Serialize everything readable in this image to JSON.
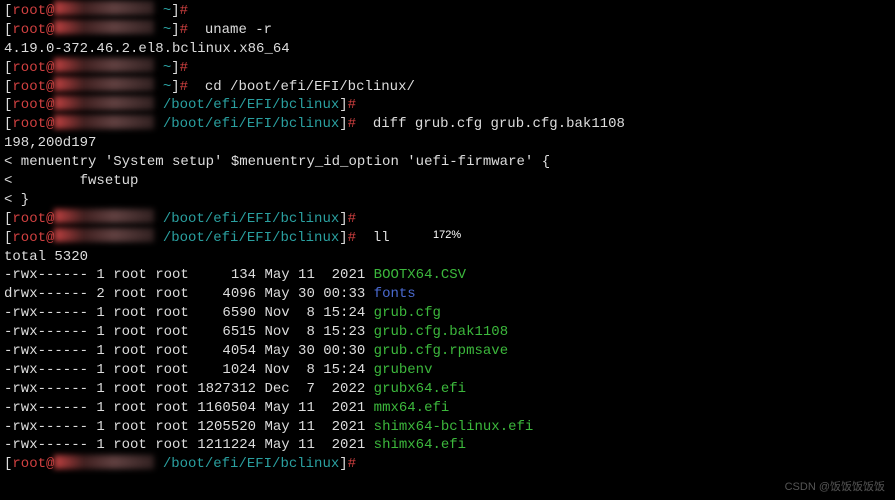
{
  "prompt": {
    "user": "root@",
    "home_dir": "~",
    "boot_dir": "/boot/efi/EFI/bclinux"
  },
  "commands": {
    "uname": "uname -r",
    "uname_output": "4.19.0-372.46.2.el8.bclinux.x86_64",
    "cd": "cd /boot/efi/EFI/bclinux/",
    "diff": "diff grub.cfg grub.cfg.bak1108",
    "ls": "ll"
  },
  "zoom_level": "172%",
  "diff_output": {
    "header": "198,200d197",
    "line1": "< menuentry 'System setup' $menuentry_id_option 'uefi-firmware' {",
    "line2": "<        fwsetup",
    "line3": "< }"
  },
  "ls_total": "total 5320",
  "files": [
    {
      "perms": "-rwx------",
      "links": "1",
      "owner": "root",
      "group": "root",
      "size": "    134",
      "date": "May 11  2021",
      "name": "BOOTX64.CSV",
      "type": "green"
    },
    {
      "perms": "drwx------",
      "links": "2",
      "owner": "root",
      "group": "root",
      "size": "   4096",
      "date": "May 30 00:33",
      "name": "fonts",
      "type": "blue"
    },
    {
      "perms": "-rwx------",
      "links": "1",
      "owner": "root",
      "group": "root",
      "size": "   6590",
      "date": "Nov  8 15:24",
      "name": "grub.cfg",
      "type": "green"
    },
    {
      "perms": "-rwx------",
      "links": "1",
      "owner": "root",
      "group": "root",
      "size": "   6515",
      "date": "Nov  8 15:23",
      "name": "grub.cfg.bak1108",
      "type": "green"
    },
    {
      "perms": "-rwx------",
      "links": "1",
      "owner": "root",
      "group": "root",
      "size": "   4054",
      "date": "May 30 00:30",
      "name": "grub.cfg.rpmsave",
      "type": "green"
    },
    {
      "perms": "-rwx------",
      "links": "1",
      "owner": "root",
      "group": "root",
      "size": "   1024",
      "date": "Nov  8 15:24",
      "name": "grubenv",
      "type": "green"
    },
    {
      "perms": "-rwx------",
      "links": "1",
      "owner": "root",
      "group": "root",
      "size": "1827312",
      "date": "Dec  7  2022",
      "name": "grubx64.efi",
      "type": "green"
    },
    {
      "perms": "-rwx------",
      "links": "1",
      "owner": "root",
      "group": "root",
      "size": "1160504",
      "date": "May 11  2021",
      "name": "mmx64.efi",
      "type": "green"
    },
    {
      "perms": "-rwx------",
      "links": "1",
      "owner": "root",
      "group": "root",
      "size": "1205520",
      "date": "May 11  2021",
      "name": "shimx64-bclinux.efi",
      "type": "green"
    },
    {
      "perms": "-rwx------",
      "links": "1",
      "owner": "root",
      "group": "root",
      "size": "1211224",
      "date": "May 11  2021",
      "name": "shimx64.efi",
      "type": "green"
    }
  ],
  "watermark": "CSDN @饭饭饭饭饭"
}
